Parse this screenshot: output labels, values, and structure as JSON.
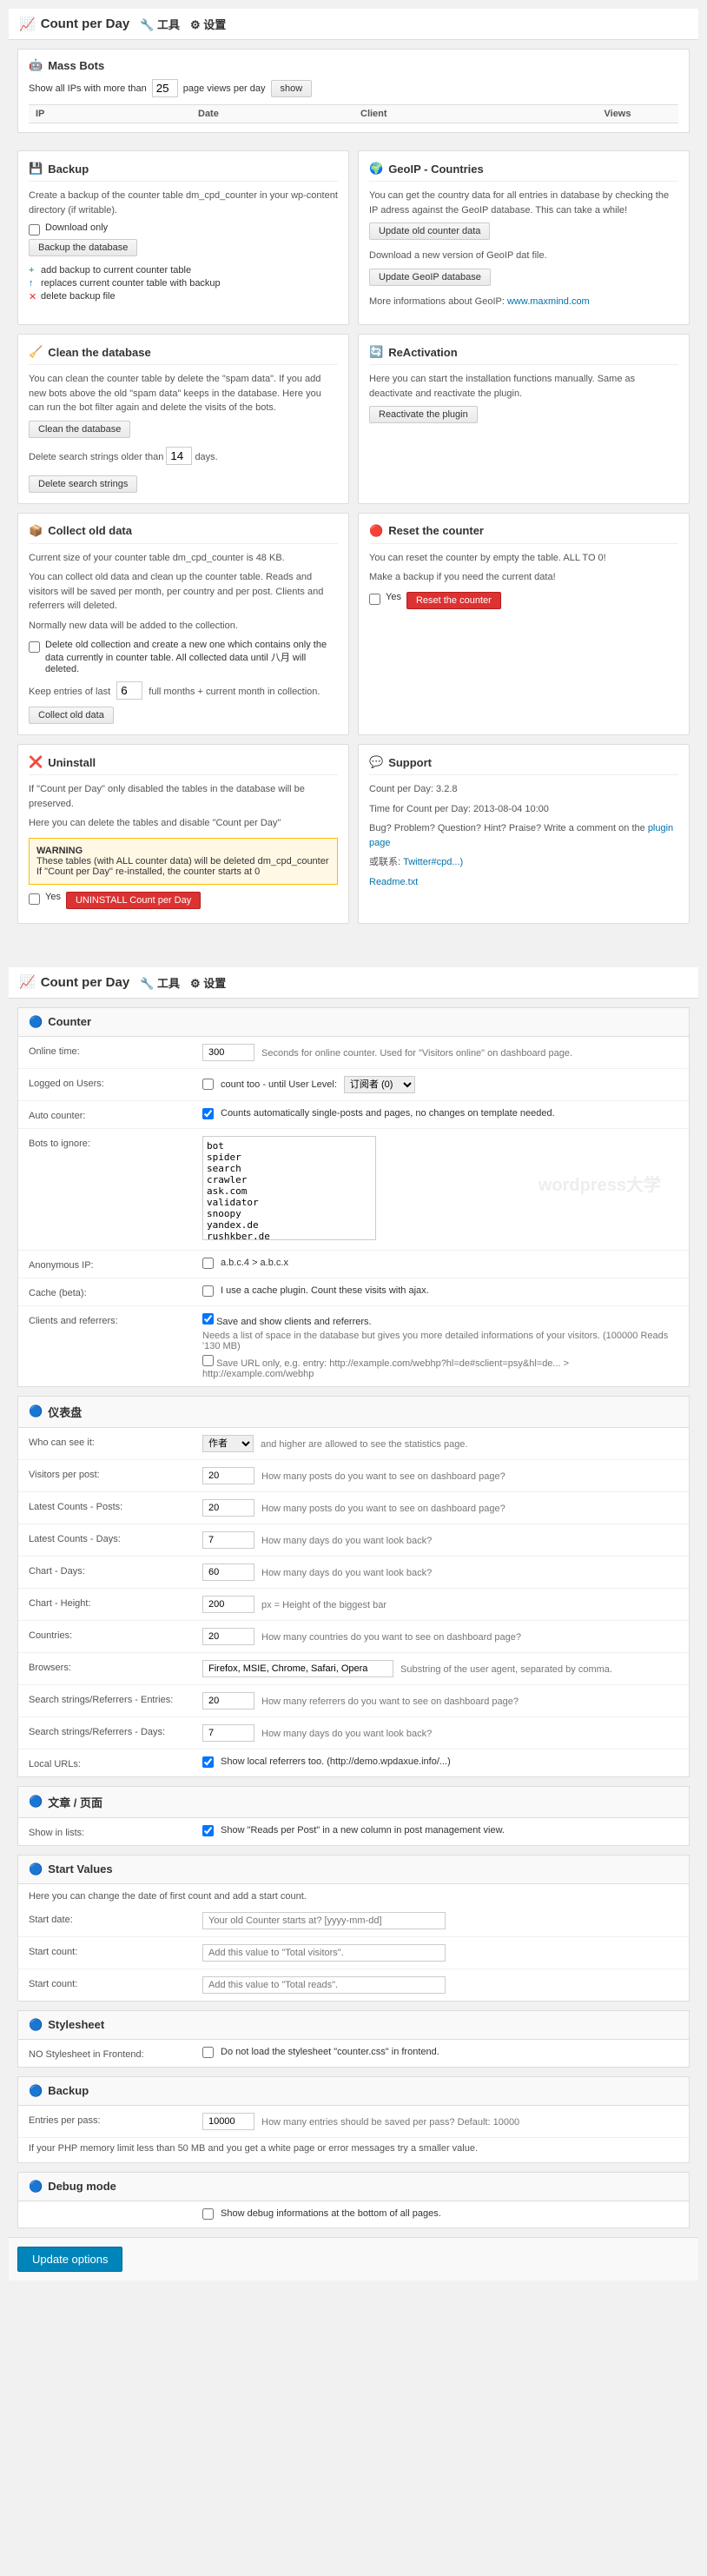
{
  "page1": {
    "header": {
      "icon": "📈",
      "title": "Count per Day",
      "tool_link": "🔧 工具",
      "settings_link": "⚙ 设置"
    },
    "mass_bots": {
      "title": "Mass Bots",
      "icon": "🤖",
      "description_prefix": "Show all IPs with more than",
      "threshold": "25",
      "description_suffix": "page views per day",
      "show_button": "show",
      "table_headers": [
        "IP",
        "Date",
        "Client",
        "Views"
      ]
    },
    "backup": {
      "title": "Backup",
      "icon": "💾",
      "description": "Create a backup of the counter table dm_cpd_counter in your wp-content directory (if writable).",
      "download_only_label": "Download only",
      "backup_button": "Backup the database",
      "list_items": [
        {
          "type": "add",
          "text": "add backup to current counter table"
        },
        {
          "type": "replace",
          "text": "replaces current counter table with backup"
        },
        {
          "type": "delete",
          "text": "delete backup file"
        }
      ]
    },
    "clean_database": {
      "title": "Clean the database",
      "icon": "🧹",
      "description1": "You can clean the counter table by delete the \"spam data\". If you add new bots above the old \"spam data\" keeps in the database. Here you can run the bot filter again and delete the visits of the bots.",
      "clean_button": "Clean the database",
      "description2": "Delete search strings older than",
      "days": "14",
      "days_suffix": "days.",
      "delete_button": "Delete search strings"
    },
    "collect_old": {
      "title": "Collect old data",
      "icon": "📦",
      "description1": "Current size of your counter table dm_cpd_counter is 48 KB.",
      "description2": "You can collect old data and clean up the counter table. Reads and visitors will be saved per month, per country and per post. Clients and referrers will deleted.",
      "description3": "Normally new data will be added to the collection.",
      "checkbox_label": "Delete old collection and create a new one which contains only the data currently in counter table. All collected data until 八月 will deleted.",
      "keep_label": "Keep entries of last",
      "keep_value": "6",
      "keep_suffix": "full months + current month in collection.",
      "collect_button": "Collect old data"
    },
    "geoip": {
      "title": "GeoIP - Countries",
      "icon": "🌍",
      "description": "You can get the country data for all entries in database by checking the IP adress against the GeoIP database. This can take a while!",
      "update_old_button": "Update old counter data",
      "download_desc": "Download a new version of GeoIP dat file.",
      "update_geoip_button": "Update GeoIP database",
      "more_info": "More informations about GeoIP:",
      "geoip_link": "www.maxmind.com"
    },
    "reactivation": {
      "title": "ReActivation",
      "icon": "🔄",
      "description": "Here you can start the installation functions manually. Same as deactivate and reactivate the plugin.",
      "button": "Reactivate the plugin"
    },
    "reset_counter": {
      "title": "Reset the counter",
      "icon": "🔴",
      "error_text1": "You can reset the counter by empty the table. ALL TO 0!",
      "error_text2": "Make a backup if you need the current data!",
      "yes_label": "Yes",
      "reset_button": "Reset the counter"
    },
    "uninstall": {
      "title": "Uninstall",
      "icon": "❌",
      "description1": "If \"Count per Day\" only disabled the tables in the database will be preserved.",
      "description2": "Here you can delete the tables and disable \"Count per Day\"",
      "warning_title": "WARNING",
      "warning_text": "These tables (with ALL counter data) will be deleted dm_cpd_counter If \"Count per Day\" re-installed, the counter starts at 0",
      "yes_label": "Yes",
      "uninstall_button": "UNINSTALL Count per Day"
    },
    "support": {
      "title": "Support",
      "icon": "💬",
      "version_label": "Count per Day:",
      "version": "3.2.8",
      "time_label": "Time for Count per Day:",
      "time": "2013-08-04 10:00",
      "bug_text": "Bug? Problem? Question? Hint? Praise? Write a comment on the",
      "plugin_link": "plugin page",
      "or_text": "或联系:",
      "twitter_link": "Twitter#cpd...)",
      "readme_link": "Readme.txt"
    }
  },
  "page2": {
    "header": {
      "icon": "📈",
      "title": "Count per Day",
      "tool_link": "🔧 工具",
      "settings_link": "⚙ 设置"
    },
    "counter_section": {
      "title": "Counter",
      "icon": "🔵",
      "rows": [
        {
          "label": "Online time:",
          "value": "300",
          "desc": "Seconds for online counter. Used for \"Visitors online\" on dashboard page."
        },
        {
          "label": "Logged on Users:",
          "value": "count too - until User Level:",
          "select_value": "订阅者 (0)",
          "type": "checkbox_select"
        },
        {
          "label": "Auto counter:",
          "value": "Counts automatically single-posts and pages, no changes on template needed.",
          "type": "checkbox_text"
        },
        {
          "label": "Bots to ignore:",
          "value": "bot\nspider\nsearch\ncrawler\nask.com\nvalidator\nsnoopy\nyandex.de\nrushkber.de\nshelob",
          "type": "textarea"
        },
        {
          "label": "Anonymous IP:",
          "value": "a.b.c.4 > a.b.c.x",
          "type": "checkbox_text"
        },
        {
          "label": "Cache (beta):",
          "value": "I use a cache plugin. Count these visits with ajax.",
          "type": "checkbox_text"
        },
        {
          "label": "Clients and referrers:",
          "line1": "Save and show clients and referrers.",
          "line2": "Needs a list of space in the database but gives you more detailed informations of your visitors. (100000 Reads '130 MB)",
          "line3": "Save URL only, e.g. entry: http://example.com/webhp?hl=de#sclient=psy&hl=de... > http://example.com/webhp",
          "type": "multi"
        }
      ]
    },
    "dashboard_section": {
      "title": "仪表盘",
      "icon": "🔵",
      "rows": [
        {
          "label": "Who can see it:",
          "value": "作者",
          "desc": "and higher are allowed to see the statistics page.",
          "type": "select_text"
        },
        {
          "label": "Visitors per post:",
          "value": "20",
          "desc": "How many posts do you want to see on dashboard page?"
        },
        {
          "label": "Latest Counts - Posts:",
          "value": "20",
          "desc": "How many posts do you want to see on dashboard page?"
        },
        {
          "label": "Latest Counts - Days:",
          "value": "7",
          "desc": "How many days do you want look back?"
        },
        {
          "label": "Chart - Days:",
          "value": "60",
          "desc": "How many days do you want look back?"
        },
        {
          "label": "Chart - Height:",
          "value": "200",
          "desc": "px = Height of the biggest bar"
        },
        {
          "label": "Countries:",
          "value": "20",
          "desc": "How many countries do you want to see on dashboard page?"
        },
        {
          "label": "Browsers:",
          "value": "Firefox, MSIE, Chrome, Safari, Opera",
          "desc": "Substring of the user agent, separated by comma."
        },
        {
          "label": "Search strings/Referrers - Entries:",
          "value": "20",
          "desc": "How many referrers do you want to see on dashboard page?"
        },
        {
          "label": "Search strings/Referrers - Days:",
          "value": "7",
          "desc": "How many days do you want look back?"
        },
        {
          "label": "Local URLs:",
          "value": "Show local referrers too. (http://demo.wpdaxue.info/...)",
          "type": "checkbox_text"
        }
      ]
    },
    "posts_section": {
      "title": "文章 / 页面",
      "icon": "🔵",
      "rows": [
        {
          "label": "Show in lists:",
          "value": "Show \"Reads per Post\" in a new column in post management view.",
          "type": "checkbox_text"
        }
      ]
    },
    "start_values": {
      "title": "Start Values",
      "icon": "🔵",
      "description": "Here you can change the date of first count and add a start count.",
      "rows": [
        {
          "label": "Start date:",
          "value": "Your old Counter starts at? [yyyy-mm-dd]",
          "type": "placeholder_text"
        },
        {
          "label": "Start count:",
          "value": "Add this value to \"Total visitors\".",
          "type": "placeholder_text"
        },
        {
          "label": "Start count:",
          "value": "Add this value to \"Total reads\".",
          "type": "placeholder_text"
        }
      ]
    },
    "stylesheet": {
      "title": "Stylesheet",
      "icon": "🔵",
      "rows": [
        {
          "label": "NO Stylesheet in Frontend:",
          "value": "Do not load the stylesheet \"counter.css\" in frontend.",
          "type": "checkbox_text"
        }
      ]
    },
    "backup_section": {
      "title": "Backup",
      "icon": "🔵",
      "rows": [
        {
          "label": "Entries per pass:",
          "value": "10000",
          "desc": "How many entries should be saved per pass? Default: 10000"
        }
      ],
      "footer_note": "If your PHP memory limit less than 50 MB and you get a white page or error messages try a smaller value."
    },
    "debug_section": {
      "title": "Debug mode",
      "icon": "🔵",
      "rows": [
        {
          "label": "",
          "value": "Show debug informations at the bottom of all pages.",
          "type": "checkbox_text"
        }
      ]
    },
    "submit_button": "Update options"
  }
}
